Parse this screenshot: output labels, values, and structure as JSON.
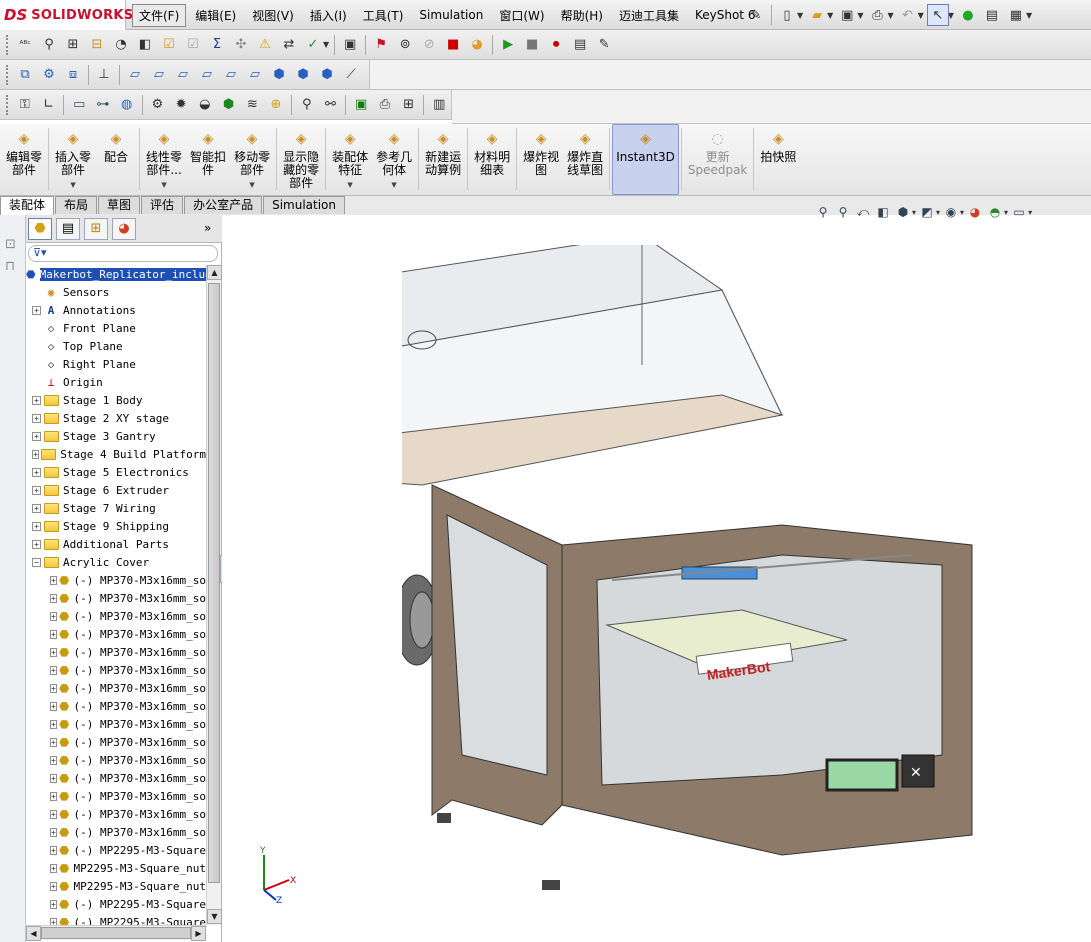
{
  "app": {
    "name": "SOLIDWORKS",
    "logo": "DS"
  },
  "menu": [
    "文件(F)",
    "编辑(E)",
    "视图(V)",
    "插入(I)",
    "工具(T)",
    "Simulation",
    "窗口(W)",
    "帮助(H)",
    "迈迪工具集",
    "KeyShot 6"
  ],
  "command_manager": [
    {
      "label": "编辑零\n部件",
      "icon": "edit-component-icon"
    },
    {
      "label": "插入零\n部件",
      "icon": "insert-component-icon",
      "dropdown": true
    },
    {
      "label": "配合",
      "icon": "mate-icon"
    },
    {
      "label": "线性零\n部件...",
      "icon": "linear-pattern-icon",
      "dropdown": true
    },
    {
      "label": "智能扣\n件",
      "icon": "smart-fastener-icon"
    },
    {
      "label": "移动零\n部件",
      "icon": "move-component-icon",
      "dropdown": true
    },
    {
      "label": "显示隐\n藏的零\n部件",
      "icon": "show-hidden-icon"
    },
    {
      "label": "装配体\n特征",
      "icon": "assembly-feature-icon",
      "dropdown": true
    },
    {
      "label": "参考几\n何体",
      "icon": "reference-geometry-icon",
      "dropdown": true
    },
    {
      "label": "新建运\n动算例",
      "icon": "motion-study-icon"
    },
    {
      "label": "材料明\n细表",
      "icon": "bom-icon"
    },
    {
      "label": "爆炸视\n图",
      "icon": "exploded-view-icon"
    },
    {
      "label": "爆炸直\n线草图",
      "icon": "explode-line-icon"
    },
    {
      "label": "Instant3D",
      "icon": "instant3d-icon",
      "active": true
    },
    {
      "label": "更新\nSpeedpak",
      "icon": "speedpak-icon",
      "disabled": true
    },
    {
      "label": "拍快照",
      "icon": "snapshot-icon"
    }
  ],
  "tabs": [
    "装配体",
    "布局",
    "草图",
    "评估",
    "办公室产品",
    "Simulation"
  ],
  "tree": {
    "root": "Makerbot_Replicator_includ",
    "items": [
      {
        "label": "Sensors",
        "type": "sensor",
        "expand": false
      },
      {
        "label": "Annotations",
        "type": "annotation",
        "expand": true
      },
      {
        "label": "Front Plane",
        "type": "plane",
        "expand": false
      },
      {
        "label": "Top Plane",
        "type": "plane",
        "expand": false
      },
      {
        "label": "Right Plane",
        "type": "plane",
        "expand": false
      },
      {
        "label": "Origin",
        "type": "origin",
        "expand": false
      },
      {
        "label": "Stage 1 Body",
        "type": "folder",
        "expand": true
      },
      {
        "label": "Stage 2 XY stage",
        "type": "folder",
        "expand": true
      },
      {
        "label": "Stage 3 Gantry",
        "type": "folder",
        "expand": true
      },
      {
        "label": "Stage 4 Build Platform",
        "type": "folder",
        "expand": true
      },
      {
        "label": "Stage 5 Electronics",
        "type": "folder",
        "expand": true
      },
      {
        "label": "Stage 6 Extruder",
        "type": "folder",
        "expand": true
      },
      {
        "label": "Stage 7 Wiring",
        "type": "folder",
        "expand": true
      },
      {
        "label": "Stage 9 Shipping",
        "type": "folder",
        "expand": true
      },
      {
        "label": "Additional Parts",
        "type": "folder",
        "expand": true
      },
      {
        "label": "Acrylic Cover",
        "type": "folder",
        "expand": true,
        "open": true
      }
    ],
    "children": [
      "(-) MP370-M3x16mm_so",
      "(-) MP370-M3x16mm_so",
      "(-) MP370-M3x16mm_so",
      "(-) MP370-M3x16mm_so",
      "(-) MP370-M3x16mm_so",
      "(-) MP370-M3x16mm_so",
      "(-) MP370-M3x16mm_so",
      "(-) MP370-M3x16mm_so",
      "(-) MP370-M3x16mm_so",
      "(-) MP370-M3x16mm_so",
      "(-) MP370-M3x16mm_so",
      "(-) MP370-M3x16mm_so",
      "(-) MP370-M3x16mm_so",
      "(-) MP370-M3x16mm_so",
      "(-) MP370-M3x16mm_so",
      "(-) MP2295-M3-Square",
      "MP2295-M3-Square_nut",
      "MP2295-M3-Square_nut",
      "(-) MP2295-M3-Square",
      "(-) MP2295-M3-Square"
    ]
  },
  "model": {
    "brand_text": "MakerBot"
  },
  "triad": {
    "x": "X",
    "y": "Y",
    "z": "Z"
  },
  "colors": {
    "logo_red": "#c8102e",
    "selection_blue": "#1e4fb5",
    "panel_wood": "#8e7a68",
    "active_cmd": "#c8d2ee"
  }
}
